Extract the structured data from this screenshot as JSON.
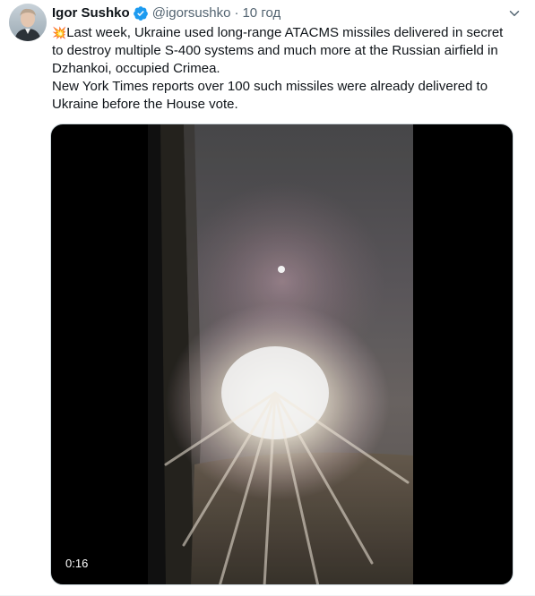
{
  "author": {
    "name": "Igor Sushko",
    "handle": "@igorsushko",
    "separator": "·",
    "time": "10 год",
    "verified": true,
    "avatar_icon": "user-avatar",
    "verified_icon": "verified-badge-icon"
  },
  "tweet": {
    "emoji": "💥",
    "paragraph1": "Last week, Ukraine used long-range ATACMS missiles delivered in secret to destroy multiple S-400 systems and much more at the Russian airfield in Dzhankoi, occupied Crimea.",
    "paragraph2": "New York Times reports over 100 such missiles were already delivered to Ukraine before the House vote."
  },
  "media": {
    "type": "video",
    "duration": "0:16"
  },
  "colors": {
    "text": "#0f1419",
    "secondary": "#536471",
    "verified": "#1d9bf0",
    "media_bg": "#000000"
  }
}
